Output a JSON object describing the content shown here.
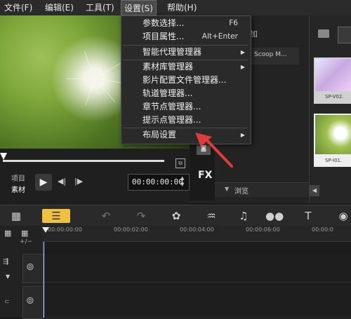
{
  "menubar": {
    "items": [
      "文件(F)",
      "编辑(E)",
      "工具(T)",
      "设置(S)",
      "帮助(H)"
    ]
  },
  "dropdown": {
    "items": [
      {
        "label": "参数选择...",
        "shortcut": "F6"
      },
      {
        "label": "项目属性...",
        "shortcut": "Alt+Enter"
      },
      {
        "label": "智能代理管理器",
        "submenu": true
      },
      {
        "label": "素材库管理器",
        "submenu": true
      },
      {
        "label": "影片配置文件管理器..."
      },
      {
        "label": "轨道管理器..."
      },
      {
        "label": "章节点管理器..."
      },
      {
        "label": "提示点管理器..."
      },
      {
        "label": "布局设置",
        "submenu": true
      }
    ]
  },
  "preview": {
    "mode_project": "项目",
    "mode_clip": "素材",
    "timecode": "00:00:00:00"
  },
  "middle_panel": {
    "tab_add": "加",
    "list_item": "Scoop M...",
    "fx_label": "FX",
    "browse_label": "浏览"
  },
  "library": {
    "thumb1_label": "SP-V02.",
    "thumb2_label": "SP-I01."
  },
  "ruler": {
    "ticks": [
      "00:00:00:00",
      "00:00:02:00",
      "00:00:04:00",
      "00:00:06:00",
      "00:00:0"
    ]
  },
  "colors": {
    "accent": "#e03a3a",
    "menu_bg": "#2b2b2b",
    "highlight": "#4a4a4a"
  }
}
